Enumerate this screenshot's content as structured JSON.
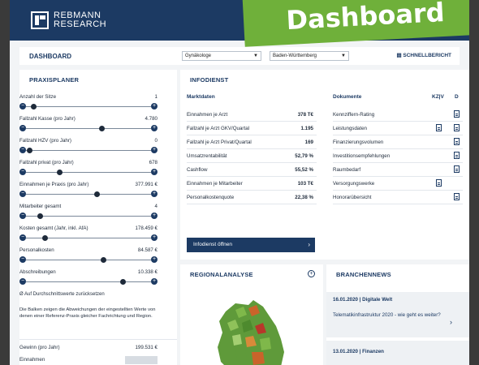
{
  "brand": {
    "line1": "REBMANN",
    "line2": "RESEARCH"
  },
  "ribbon": "Dashboard",
  "dashboard": {
    "title": "DASHBOARD",
    "select1": "Gynäkologe",
    "select2": "Baden-Württemberg",
    "schnellbericht": "SCHNELLBERICHT"
  },
  "praxisplaner": {
    "title": "PRAXISPLANER",
    "rows": [
      {
        "label": "Anzahl der Sitze",
        "value": "1"
      },
      {
        "label": "Fallzahl Kasse (pro Jahr)",
        "value": "4.780"
      },
      {
        "label": "Fallzahl HZV (pro Jahr)",
        "value": "0"
      },
      {
        "label": "Fallzahl privat (pro Jahr)",
        "value": "678"
      },
      {
        "label": "Einnahmen je Praxis (pro Jahr)",
        "value": "377.991 €"
      },
      {
        "label": "Mitarbeiter gesamt",
        "value": "4"
      },
      {
        "label": "Kosten gesamt (Jahr, inkl. AfA)",
        "value": "178.459 €"
      },
      {
        "label": "Personalkosten",
        "value": "84.587 €"
      },
      {
        "label": "Abschreibungen",
        "value": "10.338 €"
      }
    ],
    "reset": "Ø  Auf Durchschnittswerte zurücksetzen",
    "note": "Die Balken zeigen die Abweichungen der eingestellten Werte von denen einer Referenz-Praxis gleicher Fachrichtung und Region.",
    "gewinn_label": "Gewinn (pro Jahr)",
    "gewinn_value": "199.531 €",
    "einnahmen_label": "Einnahmen"
  },
  "infodienst": {
    "title": "INFODIENST",
    "marktdaten_head": "Marktdaten",
    "dokumente_head": "Dokumente",
    "col_kzv": "KZ|V",
    "col_d": "D",
    "marktdaten": [
      {
        "label": "Einnahmen je Arzt",
        "value": "378 T€"
      },
      {
        "label": "Fallzahl je Arzt GKV/Quartal",
        "value": "1.195"
      },
      {
        "label": "Fallzahl je Arzt Privat/Quartal",
        "value": "169"
      },
      {
        "label": "Umsatzrentabilität",
        "value": "52,79 %"
      },
      {
        "label": "Cashflow",
        "value": "55,52 %"
      },
      {
        "label": "Einnahmen je Mitarbeiter",
        "value": "103 T€"
      },
      {
        "label": "Personalkostenquote",
        "value": "22,38 %"
      }
    ],
    "dokumente": [
      "Kennziffern-Rating",
      "Leistungsdaten",
      "Finanzierungsvolumen",
      "Investitionsempfehlungen",
      "Raumbedarf",
      "Versorgungswerke",
      "Honorarübersicht"
    ],
    "button": "Infodienst öffnen"
  },
  "regional": {
    "title": "REGIONALANALYSE"
  },
  "news": {
    "title": "BRANCHENNEWS",
    "items": [
      {
        "date": "16.01.2020 | Digitale Welt",
        "headline": "Telematikinfrastruktur 2020 - wie geht es weiter?"
      },
      {
        "date": "13.01.2020 | Finanzen",
        "headline": ""
      }
    ]
  }
}
